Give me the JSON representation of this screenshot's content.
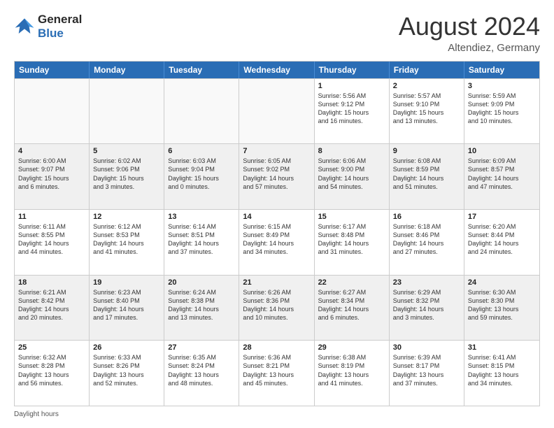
{
  "logo": {
    "line1": "General",
    "line2": "Blue"
  },
  "title": "August 2024",
  "location": "Altendiez, Germany",
  "days_of_week": [
    "Sunday",
    "Monday",
    "Tuesday",
    "Wednesday",
    "Thursday",
    "Friday",
    "Saturday"
  ],
  "footer": "Daylight hours",
  "weeks": [
    [
      {
        "day": "",
        "info": "",
        "empty": true
      },
      {
        "day": "",
        "info": "",
        "empty": true
      },
      {
        "day": "",
        "info": "",
        "empty": true
      },
      {
        "day": "",
        "info": "",
        "empty": true
      },
      {
        "day": "1",
        "info": "Sunrise: 5:56 AM\nSunset: 9:12 PM\nDaylight: 15 hours\nand 16 minutes."
      },
      {
        "day": "2",
        "info": "Sunrise: 5:57 AM\nSunset: 9:10 PM\nDaylight: 15 hours\nand 13 minutes."
      },
      {
        "day": "3",
        "info": "Sunrise: 5:59 AM\nSunset: 9:09 PM\nDaylight: 15 hours\nand 10 minutes."
      }
    ],
    [
      {
        "day": "4",
        "info": "Sunrise: 6:00 AM\nSunset: 9:07 PM\nDaylight: 15 hours\nand 6 minutes."
      },
      {
        "day": "5",
        "info": "Sunrise: 6:02 AM\nSunset: 9:06 PM\nDaylight: 15 hours\nand 3 minutes."
      },
      {
        "day": "6",
        "info": "Sunrise: 6:03 AM\nSunset: 9:04 PM\nDaylight: 15 hours\nand 0 minutes."
      },
      {
        "day": "7",
        "info": "Sunrise: 6:05 AM\nSunset: 9:02 PM\nDaylight: 14 hours\nand 57 minutes."
      },
      {
        "day": "8",
        "info": "Sunrise: 6:06 AM\nSunset: 9:00 PM\nDaylight: 14 hours\nand 54 minutes."
      },
      {
        "day": "9",
        "info": "Sunrise: 6:08 AM\nSunset: 8:59 PM\nDaylight: 14 hours\nand 51 minutes."
      },
      {
        "day": "10",
        "info": "Sunrise: 6:09 AM\nSunset: 8:57 PM\nDaylight: 14 hours\nand 47 minutes."
      }
    ],
    [
      {
        "day": "11",
        "info": "Sunrise: 6:11 AM\nSunset: 8:55 PM\nDaylight: 14 hours\nand 44 minutes."
      },
      {
        "day": "12",
        "info": "Sunrise: 6:12 AM\nSunset: 8:53 PM\nDaylight: 14 hours\nand 41 minutes."
      },
      {
        "day": "13",
        "info": "Sunrise: 6:14 AM\nSunset: 8:51 PM\nDaylight: 14 hours\nand 37 minutes."
      },
      {
        "day": "14",
        "info": "Sunrise: 6:15 AM\nSunset: 8:49 PM\nDaylight: 14 hours\nand 34 minutes."
      },
      {
        "day": "15",
        "info": "Sunrise: 6:17 AM\nSunset: 8:48 PM\nDaylight: 14 hours\nand 31 minutes."
      },
      {
        "day": "16",
        "info": "Sunrise: 6:18 AM\nSunset: 8:46 PM\nDaylight: 14 hours\nand 27 minutes."
      },
      {
        "day": "17",
        "info": "Sunrise: 6:20 AM\nSunset: 8:44 PM\nDaylight: 14 hours\nand 24 minutes."
      }
    ],
    [
      {
        "day": "18",
        "info": "Sunrise: 6:21 AM\nSunset: 8:42 PM\nDaylight: 14 hours\nand 20 minutes."
      },
      {
        "day": "19",
        "info": "Sunrise: 6:23 AM\nSunset: 8:40 PM\nDaylight: 14 hours\nand 17 minutes."
      },
      {
        "day": "20",
        "info": "Sunrise: 6:24 AM\nSunset: 8:38 PM\nDaylight: 14 hours\nand 13 minutes."
      },
      {
        "day": "21",
        "info": "Sunrise: 6:26 AM\nSunset: 8:36 PM\nDaylight: 14 hours\nand 10 minutes."
      },
      {
        "day": "22",
        "info": "Sunrise: 6:27 AM\nSunset: 8:34 PM\nDaylight: 14 hours\nand 6 minutes."
      },
      {
        "day": "23",
        "info": "Sunrise: 6:29 AM\nSunset: 8:32 PM\nDaylight: 14 hours\nand 3 minutes."
      },
      {
        "day": "24",
        "info": "Sunrise: 6:30 AM\nSunset: 8:30 PM\nDaylight: 13 hours\nand 59 minutes."
      }
    ],
    [
      {
        "day": "25",
        "info": "Sunrise: 6:32 AM\nSunset: 8:28 PM\nDaylight: 13 hours\nand 56 minutes."
      },
      {
        "day": "26",
        "info": "Sunrise: 6:33 AM\nSunset: 8:26 PM\nDaylight: 13 hours\nand 52 minutes."
      },
      {
        "day": "27",
        "info": "Sunrise: 6:35 AM\nSunset: 8:24 PM\nDaylight: 13 hours\nand 48 minutes."
      },
      {
        "day": "28",
        "info": "Sunrise: 6:36 AM\nSunset: 8:21 PM\nDaylight: 13 hours\nand 45 minutes."
      },
      {
        "day": "29",
        "info": "Sunrise: 6:38 AM\nSunset: 8:19 PM\nDaylight: 13 hours\nand 41 minutes."
      },
      {
        "day": "30",
        "info": "Sunrise: 6:39 AM\nSunset: 8:17 PM\nDaylight: 13 hours\nand 37 minutes."
      },
      {
        "day": "31",
        "info": "Sunrise: 6:41 AM\nSunset: 8:15 PM\nDaylight: 13 hours\nand 34 minutes."
      }
    ]
  ]
}
